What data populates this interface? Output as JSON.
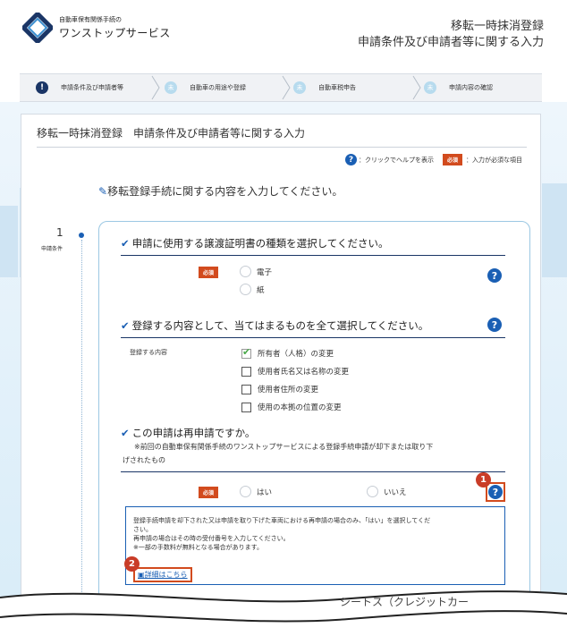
{
  "header": {
    "logo_small": "自動車保有関係手続の",
    "logo_main": "ワンストップサービス",
    "title_line1": "移転一時抹消登録",
    "title_line2": "申請条件及び申請者等に関する入力"
  },
  "steps": [
    {
      "label": "申請条件及び申請者等",
      "mark": "!"
    },
    {
      "label": "自動車の用途や登録",
      "mark": "未"
    },
    {
      "label": "自動車税申告",
      "mark": "未"
    },
    {
      "label": "申請内容の確認",
      "mark": "未"
    }
  ],
  "panel": {
    "title": "移転一時抹消登録　申請条件及び申請者等に関する入力",
    "legend_help": "：クリックでヘルプを表示",
    "required_badge": "必須",
    "legend_required": "：入力が必須な項目"
  },
  "section": {
    "lead": "移転登録手続に関する内容を入力してください。",
    "side_number": "1",
    "side_label": "申請条件"
  },
  "q1": {
    "heading": "申請に使用する譲渡証明書の種類を選択してください。",
    "options": [
      "電子",
      "紙"
    ]
  },
  "q2": {
    "heading": "登録する内容として、当てはまるものを全て選択してください。",
    "field_label": "登録する内容",
    "options": [
      "所有者（人格）の変更",
      "使用者氏名又は名称の変更",
      "使用者住所の変更",
      "使用の本拠の位置の変更"
    ]
  },
  "q3": {
    "heading": "この申請は再申請ですか。",
    "note_line1": "※前回の自動車保有関係手続のワンストップサービスによる登録手続申請が却下または取り下",
    "note_line2": "げされたもの",
    "options": [
      "はい",
      "いいえ"
    ]
  },
  "help": {
    "line1": "登録手続申請を却下された又は申請を取り下げた車両における再申請の場合のみ、「はい」を選択してくだ",
    "line2": "さい。",
    "line3": "再申請の場合はその時の受付番号を入力してください。",
    "line4": "※一部の手数料が無料となる場合があります。",
    "detail_link": "詳細はこちら"
  },
  "markers": [
    "1",
    "2"
  ],
  "cut_text": "シートス（クレジットカー"
}
